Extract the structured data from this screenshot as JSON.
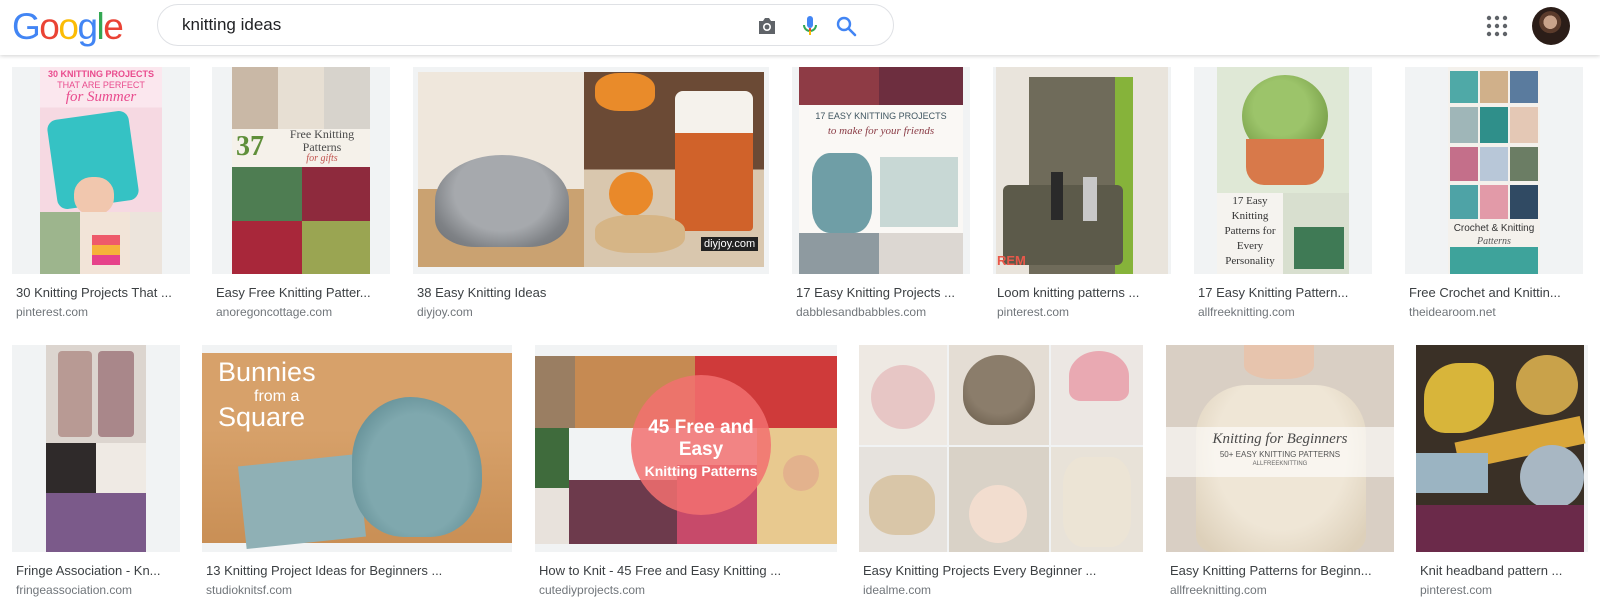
{
  "header": {
    "logo_letters": [
      {
        "ch": "G",
        "color": "#4285F4"
      },
      {
        "ch": "o",
        "color": "#EA4335"
      },
      {
        "ch": "o",
        "color": "#FBBC05"
      },
      {
        "ch": "g",
        "color": "#4285F4"
      },
      {
        "ch": "l",
        "color": "#34A853"
      },
      {
        "ch": "e",
        "color": "#EA4335"
      }
    ],
    "search_value": "knitting ideas"
  },
  "results": [
    {
      "title": "30 Knitting Projects That ...",
      "source": "pinterest.com",
      "overlay": [
        "30 KNITTING PROJECTS",
        "THAT ARE PERFECT",
        "for Summer"
      ]
    },
    {
      "title": "Easy Free Knitting Patter...",
      "source": "anoregoncottage.com",
      "overlay": [
        "37",
        "Free Knitting",
        "Patterns",
        "for gifts"
      ]
    },
    {
      "title": "38 Easy Knitting Ideas",
      "source": "diyjoy.com",
      "overlay": [
        "diyjoy.com"
      ]
    },
    {
      "title": "17 Easy Knitting Projects ...",
      "source": "dabblesandbabbles.com",
      "overlay": [
        "17 EASY KNITTING PROJECTS",
        "to make for your friends"
      ]
    },
    {
      "title": "Loom knitting patterns ...",
      "source": "pinterest.com",
      "overlay": [
        "REM"
      ]
    },
    {
      "title": "17 Easy Knitting Pattern...",
      "source": "allfreeknitting.com",
      "overlay": [
        "17 Easy",
        "Knitting",
        "Patterns for",
        "Every",
        "Personality"
      ]
    },
    {
      "title": "Free Crochet and Knittin...",
      "source": "theidearoom.net",
      "overlay": [
        "Crochet & Knitting",
        "Patterns"
      ]
    },
    {
      "title": "Fringe Association - Kn...",
      "source": "fringeassociation.com",
      "overlay": []
    },
    {
      "title": "13 Knitting Project Ideas for Beginners ...",
      "source": "studioknitsf.com",
      "overlay": [
        "Bunnies",
        "from a",
        "Square"
      ]
    },
    {
      "title": "How to Knit - 45 Free and Easy Knitting ...",
      "source": "cutediyprojects.com",
      "overlay": [
        "45 Free and",
        "Easy",
        "Knitting Patterns"
      ]
    },
    {
      "title": "Easy Knitting Projects Every Beginner ...",
      "source": "idealme.com",
      "overlay": []
    },
    {
      "title": "Easy Knitting Patterns for Beginn...",
      "source": "allfreeknitting.com",
      "overlay": [
        "Knitting for Beginners",
        "50+ EASY KNITTING PATTERNS",
        "ALLFREEKNITTING"
      ]
    },
    {
      "title": "Knit headband pattern ...",
      "source": "pinterest.com",
      "overlay": []
    }
  ]
}
